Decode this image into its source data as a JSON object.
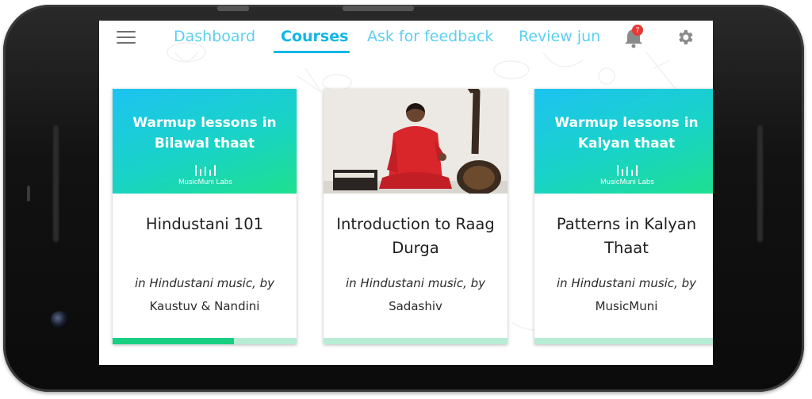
{
  "nav": {
    "tabs": [
      {
        "label": "Dashboard"
      },
      {
        "label": "Courses"
      },
      {
        "label": "Ask for feedback"
      },
      {
        "label": "Review jun"
      }
    ],
    "active_tab": "Courses",
    "notification_count": "7",
    "menu_icon": "hamburger-menu-icon",
    "bell_icon": "bell-icon",
    "settings_icon": "gear-icon"
  },
  "courses": [
    {
      "banner_text_line1": "Warmup lessons in",
      "banner_text_line2": "Bilawal thaat",
      "brand": "MusicMuni Labs",
      "title_line1": "Hindustani 101",
      "title_line2": "",
      "meta": "in Hindustani music, by",
      "author": "Kaustuv & Nandini",
      "progress": 0.66
    },
    {
      "banner_text_line1": "",
      "banner_text_line2": "",
      "brand": "",
      "title_line1": "Introduction to Raag",
      "title_line2": "Durga",
      "meta": "in Hindustani music, by",
      "author": "Sadashiv",
      "progress": 0
    },
    {
      "banner_text_line1": "Warmup lessons in",
      "banner_text_line2": "Kalyan thaat",
      "brand": "MusicMuni Labs",
      "title_line1": "Patterns in Kalyan",
      "title_line2": "Thaat",
      "meta": "in Hindustani music, by",
      "author": "MusicMuni",
      "progress": 0
    }
  ],
  "colors": {
    "accent": "#12b6e6",
    "tab_inactive": "#5cd0f0",
    "progress_fill": "#19cf82",
    "progress_track": "#b8ecd5",
    "badge": "#e53935"
  }
}
